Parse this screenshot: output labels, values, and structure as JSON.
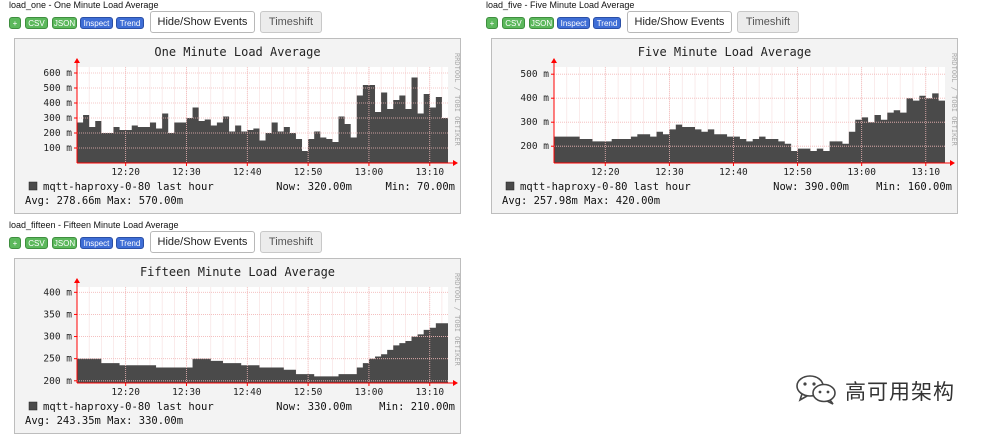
{
  "toolbar": {
    "add_label": "+",
    "csv_label": "CSV",
    "json_label": "JSON",
    "inspect_label": "Inspect",
    "trend_label": "Trend",
    "hide_show_label": "Hide/Show Events",
    "timeshift_label": "Timeshift"
  },
  "watermark": "RRDTOOL / TOBI OETIKER",
  "brand": {
    "text": "高可用架构",
    "logo": "wechat-icon"
  },
  "colors": {
    "area": "#4a4a4a",
    "grid": "#f2b8b8",
    "axis": "#ff0000",
    "tag_green": "#5cb85c",
    "tag_blue": "#3f6ed6"
  },
  "chart_data": [
    {
      "id": "one",
      "panel_title": "load_one - One Minute Load Average",
      "type": "area",
      "title": "One Minute Load Average",
      "unit_suffix": "m",
      "ylim": [
        0,
        640
      ],
      "y_ticks": [
        100,
        200,
        300,
        400,
        500,
        600
      ],
      "y_tick_labels": [
        "100 m",
        "200 m",
        "300 m",
        "400 m",
        "500 m",
        "600 m"
      ],
      "xlim": [
        "12:12",
        "13:13"
      ],
      "x_ticks": [
        "12:20",
        "12:30",
        "12:40",
        "12:50",
        "13:00",
        "13:10"
      ],
      "series": [
        {
          "name": "mqtt-haproxy-0-80 last hour",
          "x": [
            "12:12",
            "12:13",
            "12:14",
            "12:15",
            "12:16",
            "12:17",
            "12:18",
            "12:19",
            "12:20",
            "12:21",
            "12:22",
            "12:23",
            "12:24",
            "12:25",
            "12:26",
            "12:27",
            "12:28",
            "12:29",
            "12:30",
            "12:31",
            "12:32",
            "12:33",
            "12:34",
            "12:35",
            "12:36",
            "12:37",
            "12:38",
            "12:39",
            "12:40",
            "12:41",
            "12:42",
            "12:43",
            "12:44",
            "12:45",
            "12:46",
            "12:47",
            "12:48",
            "12:49",
            "12:50",
            "12:51",
            "12:52",
            "12:53",
            "12:54",
            "12:55",
            "12:56",
            "12:57",
            "12:58",
            "12:59",
            "13:00",
            "13:01",
            "13:02",
            "13:03",
            "13:04",
            "13:05",
            "13:06",
            "13:07",
            "13:08",
            "13:09",
            "13:10",
            "13:11",
            "13:12"
          ],
          "y": [
            270,
            320,
            240,
            280,
            200,
            200,
            240,
            220,
            220,
            250,
            240,
            240,
            270,
            230,
            330,
            200,
            270,
            270,
            300,
            370,
            280,
            290,
            250,
            270,
            310,
            210,
            250,
            210,
            220,
            230,
            150,
            200,
            270,
            210,
            240,
            200,
            160,
            80,
            160,
            210,
            170,
            160,
            140,
            310,
            260,
            170,
            450,
            520,
            520,
            340,
            470,
            360,
            420,
            450,
            360,
            570,
            330,
            460,
            370,
            440,
            300
          ],
          "stats": {
            "now": "320.00m",
            "min": "70.00m",
            "avg": "278.66m",
            "max": "570.00m"
          }
        }
      ]
    },
    {
      "id": "five",
      "panel_title": "load_five - Five Minute Load Average",
      "type": "area",
      "title": "Five Minute Load Average",
      "unit_suffix": "m",
      "ylim": [
        130,
        530
      ],
      "y_ticks": [
        200,
        300,
        400,
        500
      ],
      "y_tick_labels": [
        "200 m",
        "300 m",
        "400 m",
        "500 m"
      ],
      "xlim": [
        "12:12",
        "13:13"
      ],
      "x_ticks": [
        "12:20",
        "12:30",
        "12:40",
        "12:50",
        "13:00",
        "13:10"
      ],
      "series": [
        {
          "name": "mqtt-haproxy-0-80 last hour",
          "x": [
            "12:12",
            "12:13",
            "12:14",
            "12:15",
            "12:16",
            "12:17",
            "12:18",
            "12:19",
            "12:20",
            "12:21",
            "12:22",
            "12:23",
            "12:24",
            "12:25",
            "12:26",
            "12:27",
            "12:28",
            "12:29",
            "12:30",
            "12:31",
            "12:32",
            "12:33",
            "12:34",
            "12:35",
            "12:36",
            "12:37",
            "12:38",
            "12:39",
            "12:40",
            "12:41",
            "12:42",
            "12:43",
            "12:44",
            "12:45",
            "12:46",
            "12:47",
            "12:48",
            "12:49",
            "12:50",
            "12:51",
            "12:52",
            "12:53",
            "12:54",
            "12:55",
            "12:56",
            "12:57",
            "12:58",
            "12:59",
            "13:00",
            "13:01",
            "13:02",
            "13:03",
            "13:04",
            "13:05",
            "13:06",
            "13:07",
            "13:08",
            "13:09",
            "13:10",
            "13:11",
            "13:12"
          ],
          "y": [
            240,
            240,
            240,
            240,
            230,
            230,
            220,
            220,
            220,
            230,
            230,
            230,
            240,
            250,
            250,
            240,
            260,
            250,
            270,
            290,
            280,
            280,
            270,
            260,
            270,
            250,
            250,
            240,
            240,
            230,
            220,
            230,
            240,
            230,
            230,
            220,
            210,
            180,
            190,
            190,
            180,
            190,
            180,
            220,
            220,
            210,
            260,
            310,
            320,
            300,
            330,
            310,
            340,
            350,
            340,
            400,
            390,
            410,
            400,
            420,
            390
          ],
          "stats": {
            "now": "390.00m",
            "min": "160.00m",
            "avg": "257.98m",
            "max": "420.00m"
          }
        }
      ]
    },
    {
      "id": "fifteen",
      "panel_title": "load_fifteen - Fifteen Minute Load Average",
      "type": "area",
      "title": "Fifteen Minute Load Average",
      "unit_suffix": "m",
      "ylim": [
        195,
        412
      ],
      "y_ticks": [
        200,
        250,
        300,
        350,
        400
      ],
      "y_tick_labels": [
        "200 m",
        "250 m",
        "300 m",
        "350 m",
        "400 m"
      ],
      "xlim": [
        "12:12",
        "13:13"
      ],
      "x_ticks": [
        "12:20",
        "12:30",
        "12:40",
        "12:50",
        "13:00",
        "13:10"
      ],
      "series": [
        {
          "name": "mqtt-haproxy-0-80 last hour",
          "x": [
            "12:12",
            "12:13",
            "12:14",
            "12:15",
            "12:16",
            "12:17",
            "12:18",
            "12:19",
            "12:20",
            "12:21",
            "12:22",
            "12:23",
            "12:24",
            "12:25",
            "12:26",
            "12:27",
            "12:28",
            "12:29",
            "12:30",
            "12:31",
            "12:32",
            "12:33",
            "12:34",
            "12:35",
            "12:36",
            "12:37",
            "12:38",
            "12:39",
            "12:40",
            "12:41",
            "12:42",
            "12:43",
            "12:44",
            "12:45",
            "12:46",
            "12:47",
            "12:48",
            "12:49",
            "12:50",
            "12:51",
            "12:52",
            "12:53",
            "12:54",
            "12:55",
            "12:56",
            "12:57",
            "12:58",
            "12:59",
            "13:00",
            "13:01",
            "13:02",
            "13:03",
            "13:04",
            "13:05",
            "13:06",
            "13:07",
            "13:08",
            "13:09",
            "13:10",
            "13:11",
            "13:12"
          ],
          "y": [
            250,
            250,
            250,
            250,
            240,
            240,
            240,
            235,
            235,
            235,
            235,
            235,
            235,
            230,
            230,
            230,
            230,
            230,
            230,
            250,
            250,
            250,
            245,
            245,
            240,
            240,
            240,
            235,
            235,
            235,
            230,
            230,
            230,
            230,
            225,
            225,
            215,
            215,
            215,
            210,
            210,
            210,
            210,
            215,
            215,
            215,
            230,
            240,
            250,
            255,
            260,
            270,
            280,
            285,
            290,
            300,
            305,
            315,
            320,
            330,
            330
          ],
          "stats": {
            "now": "330.00m",
            "min": "210.00m",
            "avg": "243.35m",
            "max": "330.00m"
          }
        }
      ]
    }
  ]
}
